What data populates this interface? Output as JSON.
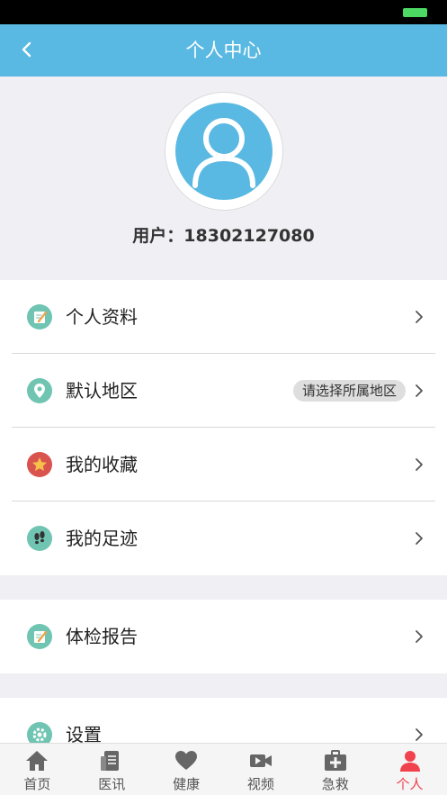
{
  "header": {
    "title": "个人中心"
  },
  "profile": {
    "user_label": "用户：",
    "phone": "18302127080"
  },
  "menu_group_1": [
    {
      "label": "个人资料",
      "icon": "edit-icon",
      "color": "#6fc4b2"
    },
    {
      "label": "默认地区",
      "icon": "location-pin-icon",
      "color": "#6fc4b2",
      "badge": "请选择所属地区"
    },
    {
      "label": "我的收藏",
      "icon": "star-icon",
      "color": "#d9534f"
    },
    {
      "label": "我的足迹",
      "icon": "footprint-icon",
      "color": "#6fc4b2"
    }
  ],
  "menu_group_2": [
    {
      "label": "体检报告",
      "icon": "report-icon",
      "color": "#6fc4b2"
    }
  ],
  "menu_group_3": [
    {
      "label": "设置",
      "icon": "gear-icon",
      "color": "#6fc4b2"
    }
  ],
  "tabs": [
    {
      "label": "首页",
      "icon": "home-icon"
    },
    {
      "label": "医讯",
      "icon": "news-icon"
    },
    {
      "label": "健康",
      "icon": "heart-icon"
    },
    {
      "label": "视频",
      "icon": "video-icon"
    },
    {
      "label": "急救",
      "icon": "first-aid-icon"
    },
    {
      "label": "个人",
      "icon": "person-icon",
      "active": true
    }
  ],
  "colors": {
    "primary": "#5ab9e2",
    "active_tab": "#f0434d",
    "background": "#efeff4",
    "battery": "#4cd964"
  }
}
